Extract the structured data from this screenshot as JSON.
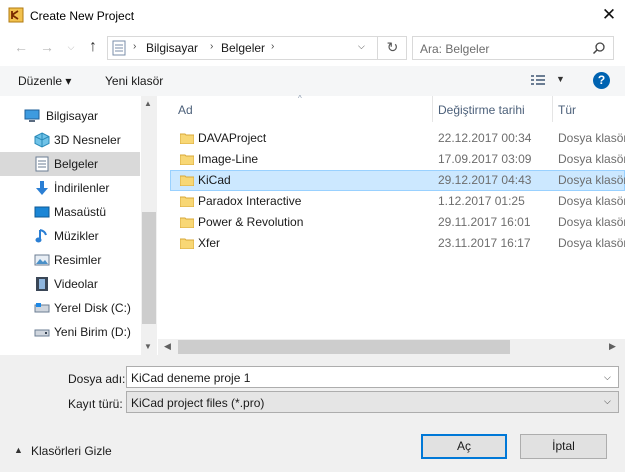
{
  "window": {
    "title": "Create New Project"
  },
  "address": {
    "segments": [
      "Bilgisayar",
      "Belgeler"
    ],
    "search_placeholder": "Ara: Belgeler"
  },
  "toolbar": {
    "organize_label": "Düzenle ▾",
    "new_folder_label": "Yeni klasör",
    "help": "?"
  },
  "sidebar": {
    "items": [
      {
        "label": "Bilgisayar",
        "icon": "computer-icon"
      },
      {
        "label": "3D Nesneler",
        "icon": "3d-objects-icon"
      },
      {
        "label": "Belgeler",
        "icon": "documents-icon",
        "selected": true
      },
      {
        "label": "İndirilenler",
        "icon": "downloads-icon"
      },
      {
        "label": "Masaüstü",
        "icon": "desktop-icon"
      },
      {
        "label": "Müzikler",
        "icon": "music-icon"
      },
      {
        "label": "Resimler",
        "icon": "pictures-icon"
      },
      {
        "label": "Videolar",
        "icon": "videos-icon"
      },
      {
        "label": "Yerel Disk (C:)",
        "icon": "local-disk-icon"
      },
      {
        "label": "Yeni Birim (D:)",
        "icon": "drive-icon"
      }
    ]
  },
  "file_list": {
    "columns": {
      "name": "Ad",
      "date": "Değiştirme tarihi",
      "type": "Tür"
    },
    "rows": [
      {
        "name": "DAVAProject",
        "date": "22.12.2017 00:34",
        "type": "Dosya klasörü"
      },
      {
        "name": "Image-Line",
        "date": "17.09.2017 03:09",
        "type": "Dosya klasörü"
      },
      {
        "name": "KiCad",
        "date": "29.12.2017 04:43",
        "type": "Dosya klasörü",
        "selected": true
      },
      {
        "name": "Paradox Interactive",
        "date": "1.12.2017 01:25",
        "type": "Dosya klasörü"
      },
      {
        "name": "Power & Revolution",
        "date": "29.11.2017 16:01",
        "type": "Dosya klasörü"
      },
      {
        "name": "Xfer",
        "date": "23.11.2017 16:17",
        "type": "Dosya klasörü"
      }
    ]
  },
  "form": {
    "filename_label": "Dosya adı:",
    "filename_value": "KiCad deneme proje 1",
    "filetype_label": "Kayıt türü:",
    "filetype_value": "KiCad project files (*.pro)"
  },
  "footer": {
    "hide_folders_label": "Klasörleri Gizle",
    "ok_label": "Aç",
    "cancel_label": "İptal"
  },
  "colors": {
    "accent": "#0078d7",
    "selection": "#cce8ff",
    "folder": "#f8d775"
  }
}
